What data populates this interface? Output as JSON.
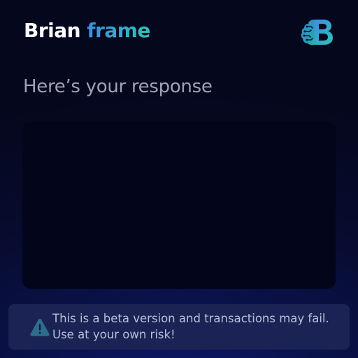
{
  "header": {
    "brand_part_1": "Brian",
    "brand_part_2": "frame",
    "logo_icon": "brain-b-logo-icon"
  },
  "main": {
    "title": "Here’s your response",
    "response_text": ""
  },
  "banner": {
    "icon": "warning-icon",
    "message": "This is a beta version and transactions may fail. Use at your own risk!"
  },
  "colors": {
    "background_top": "#05071d",
    "background_bottom": "#0d1a6b",
    "brand_gradient_start": "#3b8fe0",
    "brand_gradient_end": "#2fc2b6",
    "response_box": "#03051a",
    "banner_background": "#1a2353",
    "banner_text": "#b8bfdb",
    "title_text": "#9ea2b6"
  }
}
